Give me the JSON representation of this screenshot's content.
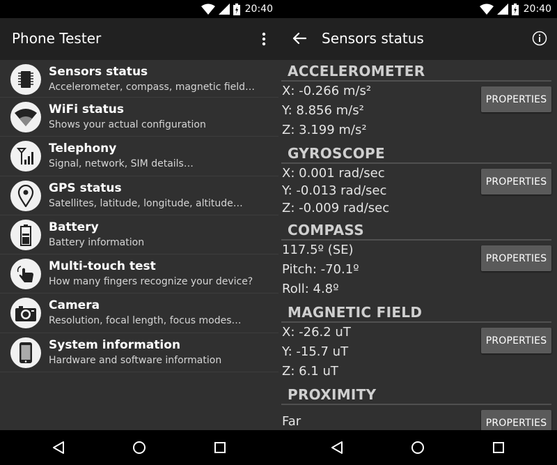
{
  "status_bar": {
    "time": "20:40"
  },
  "left_screen": {
    "app_title": "Phone Tester",
    "items": [
      {
        "title": "Sensors status",
        "subtitle": "Accelerometer, compass, magnetic field…",
        "icon": "chip-icon"
      },
      {
        "title": "WiFi status",
        "subtitle": "Shows your actual configuration",
        "icon": "wifi-icon"
      },
      {
        "title": "Telephony",
        "subtitle": "Signal, network, SIM details…",
        "icon": "signal-tower-icon"
      },
      {
        "title": "GPS status",
        "subtitle": "Satellites, latitude, longitude, altitude…",
        "icon": "location-pin-icon"
      },
      {
        "title": "Battery",
        "subtitle": "Battery information",
        "icon": "battery-icon"
      },
      {
        "title": "Multi-touch test",
        "subtitle": "How many fingers recognize your device?",
        "icon": "touch-hand-icon"
      },
      {
        "title": "Camera",
        "subtitle": "Resolution, focal length, focus modes…",
        "icon": "camera-icon"
      },
      {
        "title": "System information",
        "subtitle": "Hardware and software information",
        "icon": "phone-icon"
      }
    ]
  },
  "right_screen": {
    "title": "Sensors status",
    "properties_label": "PROPERTIES",
    "sections": [
      {
        "name": "ACCELEROMETER",
        "lines": [
          "X: -0.266 m/s²",
          "Y: 8.856 m/s²",
          "Z: 3.199 m/s²"
        ]
      },
      {
        "name": "GYROSCOPE",
        "lines": [
          "X: 0.001 rad/sec",
          "Y: -0.013 rad/sec",
          "Z: -0.009 rad/sec"
        ]
      },
      {
        "name": "COMPASS",
        "lines": [
          "117.5º (SE)",
          "Pitch: -70.1º",
          "Roll: 4.8º"
        ]
      },
      {
        "name": "MAGNETIC FIELD",
        "lines": [
          "X: -26.2 uT",
          "Y: -15.7 uT",
          "Z: 6.1 uT"
        ]
      },
      {
        "name": "PROXIMITY",
        "lines": [
          "Far"
        ]
      }
    ]
  },
  "colors": {
    "app_bar": "#212121",
    "background": "#303030",
    "button": "#5a5a5a"
  }
}
